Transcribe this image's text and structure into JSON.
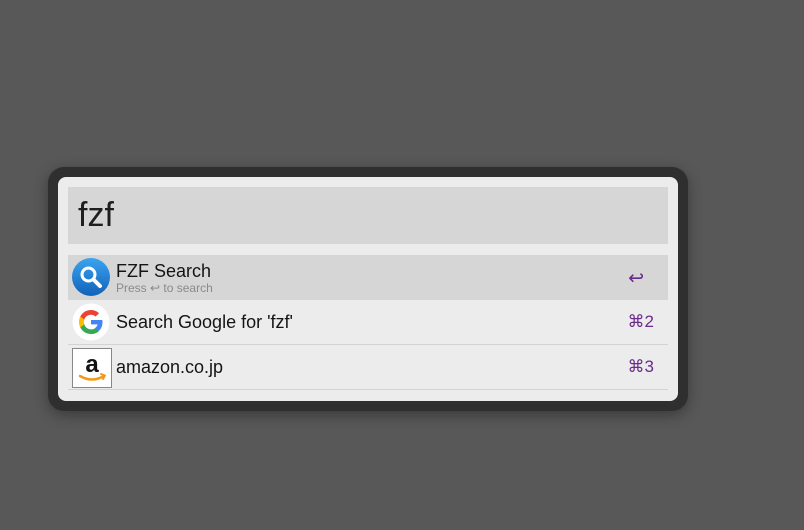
{
  "search": {
    "value": "fzf"
  },
  "results": [
    {
      "title": "FZF Search",
      "subtitle": "Press ↩ to search",
      "shortcut": "↩",
      "icon": "magnifier-icon",
      "selected": true
    },
    {
      "title": "Search Google for 'fzf'",
      "shortcut": "⌘2",
      "icon": "google-icon"
    },
    {
      "title": "amazon.co.jp",
      "shortcut": "⌘3",
      "icon": "amazon-icon"
    }
  ],
  "colors": {
    "background": "#585858",
    "frame": "#2f2f2f",
    "panel": "#ececec",
    "selected_row": "#d6d6d6",
    "shortcut_text": "#6a2c8a",
    "magnifier_blue": "#1e88d6"
  }
}
